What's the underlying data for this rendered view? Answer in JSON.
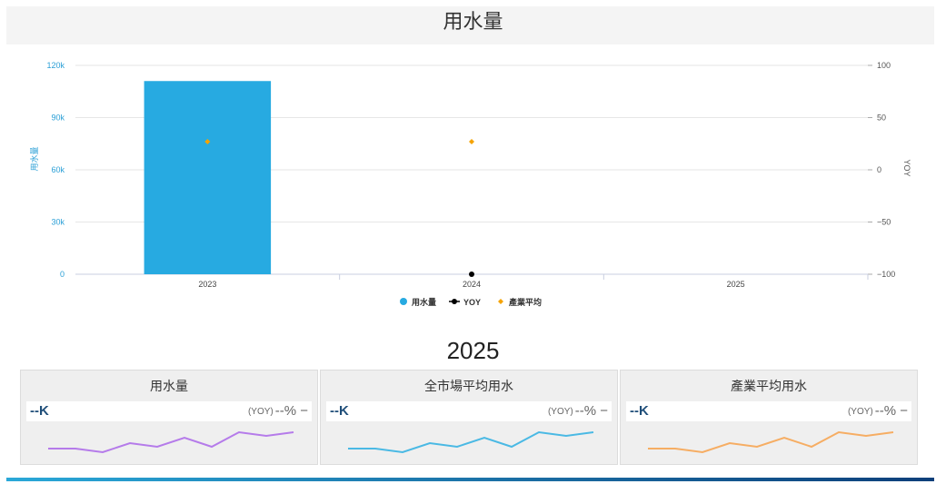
{
  "page": {
    "title": "用水量",
    "year_heading": "2025"
  },
  "colors": {
    "bar": "#27aae1",
    "yoy": "#000000",
    "industry_avg": "#f5a300",
    "spark_purple": "#b57bea",
    "spark_blue": "#4ab9e4",
    "spark_orange": "#f6ad63"
  },
  "chart_data": {
    "type": "bar",
    "title": "",
    "categories": [
      "2023",
      "2024",
      "2025"
    ],
    "series": [
      {
        "name": "用水量",
        "type": "bar",
        "axis": "left",
        "values": [
          111000,
          null,
          null
        ]
      },
      {
        "name": "YOY",
        "type": "line",
        "axis": "right",
        "values": [
          null,
          -100,
          null
        ]
      },
      {
        "name": "產業平均",
        "type": "scatter",
        "axis": "right",
        "values": [
          27,
          27,
          null
        ]
      }
    ],
    "ylabel": "用水量",
    "y2label": "YOY",
    "ylim": [
      0,
      120000
    ],
    "y2lim": [
      -100,
      100
    ],
    "yticks": [
      "0",
      "30k",
      "60k",
      "90k",
      "120k"
    ],
    "y2ticks": [
      "−100",
      "−50",
      "0",
      "50",
      "100"
    ],
    "grid": true,
    "legend_position": "bottom"
  },
  "cards": [
    {
      "title": "用水量",
      "value": "--K",
      "yoy_label": "(YOY)",
      "yoy_value": "--%",
      "trend": "−",
      "spark": [
        3,
        3,
        1,
        6,
        4,
        9,
        4,
        12,
        10,
        12
      ]
    },
    {
      "title": "全市場平均用水",
      "value": "--K",
      "yoy_label": "(YOY)",
      "yoy_value": "--%",
      "trend": "−",
      "spark": [
        3,
        3,
        1,
        6,
        4,
        9,
        4,
        12,
        10,
        12
      ]
    },
    {
      "title": "產業平均用水",
      "value": "--K",
      "yoy_label": "(YOY)",
      "yoy_value": "--%",
      "trend": "−",
      "spark": [
        3,
        3,
        1,
        6,
        4,
        9,
        4,
        12,
        10,
        12
      ]
    }
  ]
}
